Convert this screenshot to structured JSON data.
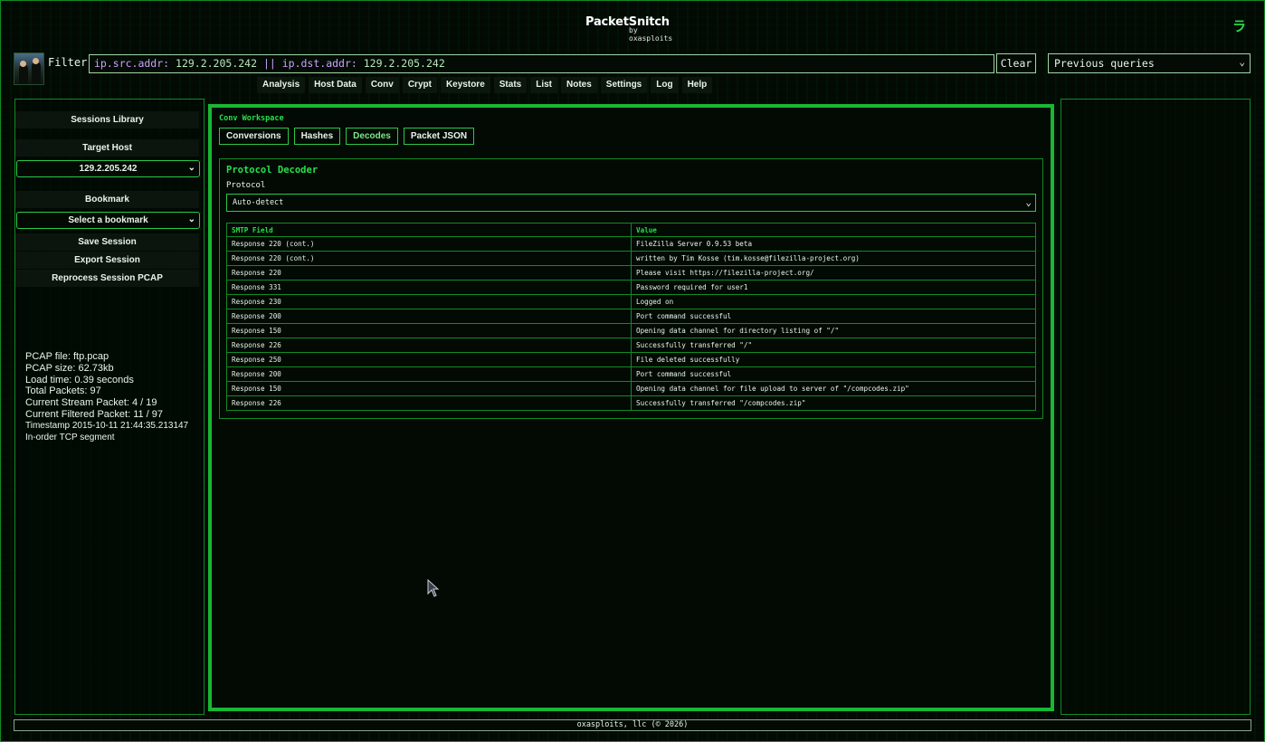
{
  "app": {
    "logo_title": "PacketSnitch",
    "logo_subtitle": "by oxasploits",
    "corner_glyph": "ラ"
  },
  "filter": {
    "label": "Filter",
    "query_tokens": [
      {
        "text": "ip.src.addr: ",
        "kind": "key"
      },
      {
        "text": "129.2.205.242",
        "kind": "value"
      },
      {
        "text": " || ",
        "kind": "op"
      },
      {
        "text": "ip.dst.addr: ",
        "kind": "key"
      },
      {
        "text": "129.2.205.242",
        "kind": "value"
      }
    ],
    "clear_label": "Clear",
    "previous_queries_label": "Previous queries"
  },
  "nav": {
    "items": [
      "Analysis",
      "Host Data",
      "Conv",
      "Crypt",
      "Keystore",
      "Stats",
      "List",
      "Notes",
      "Settings",
      "Log",
      "Help"
    ]
  },
  "sidebar": {
    "sessions_library": "Sessions Library",
    "target_host_label": "Target Host",
    "target_host_value": "129.2.205.242",
    "bookmark_label": "Bookmark",
    "bookmark_value": "Select a bookmark",
    "save_session": "Save Session",
    "export_session": "Export Session",
    "reprocess": "Reprocess Session PCAP",
    "stats": {
      "pcap_file": "PCAP file: ftp.pcap",
      "pcap_size": "PCAP size: 62.73kb",
      "load_time": "Load time: 0.39 seconds",
      "total_packets": "Total Packets: 97",
      "stream_packet": "Current Stream Packet: 4 / 19",
      "filtered_packet": "Current Filtered Packet: 11 / 97",
      "timestamp": "Timestamp 2015-10-11 21:44:35.213147",
      "segment": "In-order TCP segment"
    }
  },
  "workspace": {
    "title": "Conv Workspace",
    "tabs": [
      "Conversions",
      "Hashes",
      "Decodes",
      "Packet JSON"
    ],
    "active_tab": "Decodes",
    "decoder": {
      "title": "Protocol Decoder",
      "protocol_label": "Protocol",
      "protocol_value": "Auto-detect",
      "columns": [
        "SMTP Field",
        "Value"
      ],
      "rows": [
        [
          "Response 220 (cont.)",
          "FileZilla Server 0.9.53 beta"
        ],
        [
          "Response 220 (cont.)",
          "written by Tim Kosse (tim.kosse@filezilla-project.org)"
        ],
        [
          "Response 220",
          "Please visit https://filezilla-project.org/"
        ],
        [
          "Response 331",
          "Password required for user1"
        ],
        [
          "Response 230",
          "Logged on"
        ],
        [
          "Response 200",
          "Port command successful"
        ],
        [
          "Response 150",
          "Opening data channel for directory listing of \"/\""
        ],
        [
          "Response 226",
          "Successfully transferred \"/\""
        ],
        [
          "Response 250",
          "File deleted successfully"
        ],
        [
          "Response 200",
          "Port command successful"
        ],
        [
          "Response 150",
          "Opening data channel for file upload to server of \"/compcodes.zip\""
        ],
        [
          "Response 226",
          "Successfully transferred \"/compcodes.zip\""
        ]
      ]
    }
  },
  "footer": {
    "text": "oxasploits, llc (© 2026)"
  },
  "colors": {
    "accent": "#18b833",
    "accent_text": "#27e04b",
    "background": "#020a03",
    "filter_key": "#c8a2ff",
    "filter_value": "#ff7b72"
  }
}
